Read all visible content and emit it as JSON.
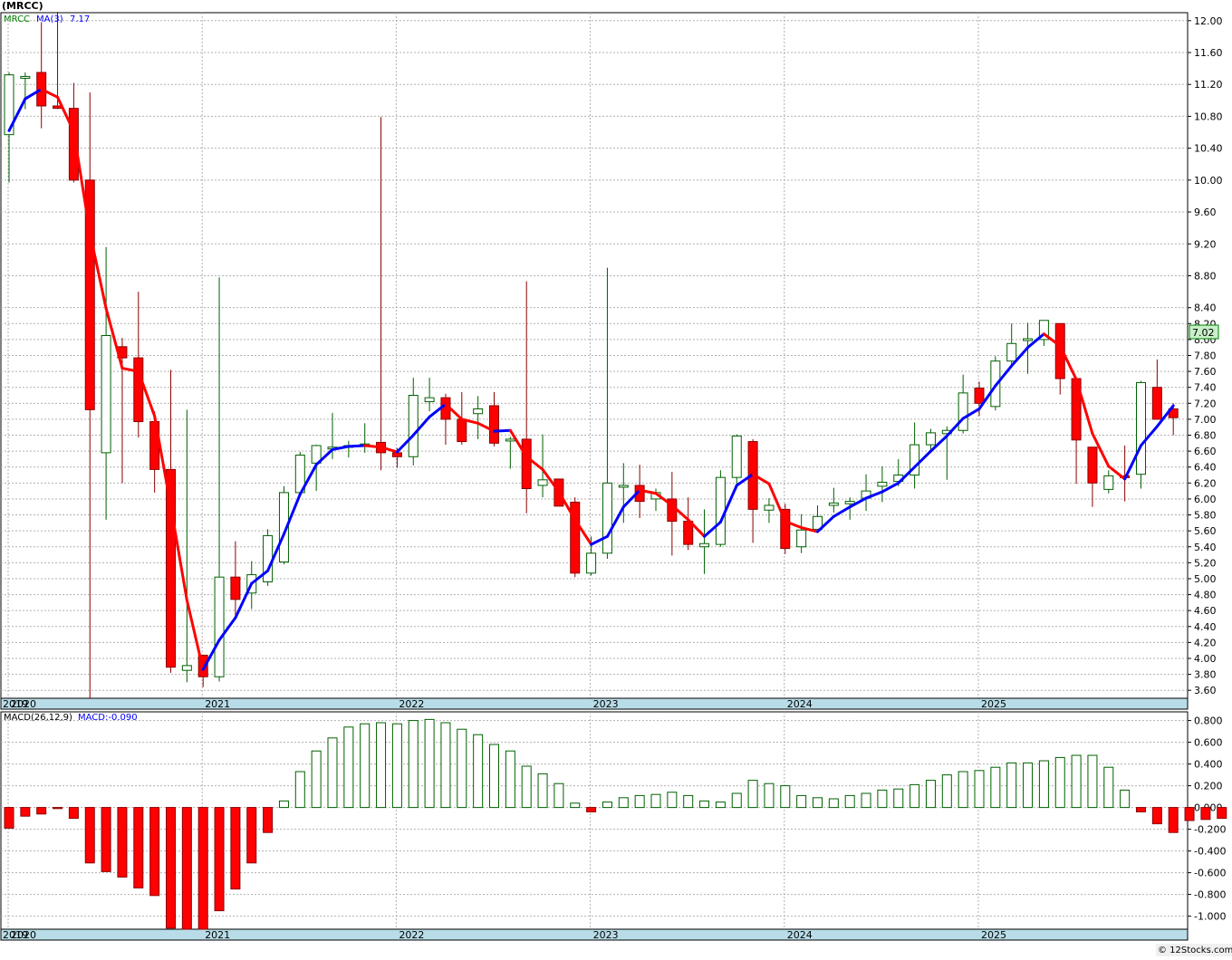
{
  "header": {
    "title": "(MRCC)"
  },
  "credit": "© 12Stocks.com",
  "colors": {
    "up": "#00a000",
    "down": "#ff0000",
    "ma_up": "#0000ff",
    "ma_down": "#ff0000",
    "grid": "#b0b0b0",
    "axis_band": "#b8dde8",
    "last_label_bg": "#c8f0c8"
  },
  "chart_data": [
    {
      "type": "candlestick",
      "title": "(MRCC)",
      "legend": {
        "symbol": "MRCC",
        "ma_label": "MA(3)",
        "ma_value": "7.17"
      },
      "last_price_label": "7.02",
      "ylim": [
        3.5,
        12.1
      ],
      "y_ticks": [
        "12.00",
        "11.60",
        "11.20",
        "10.80",
        "10.40",
        "10.00",
        "9.60",
        "9.20",
        "8.80",
        "8.40",
        "8.20",
        "8.00",
        "7.80",
        "7.60",
        "7.40",
        "7.20",
        "7.00",
        "6.80",
        "6.60",
        "6.40",
        "6.20",
        "6.00",
        "5.80",
        "5.60",
        "5.40",
        "5.20",
        "5.00",
        "4.80",
        "4.60",
        "4.40",
        "4.20",
        "4.00",
        "3.80",
        "3.60"
      ],
      "x_labels": [
        "2019",
        "2020",
        "2021",
        "2022",
        "2023",
        "2024",
        "2025"
      ],
      "x_label_index": [
        -4,
        0,
        12,
        24,
        36,
        48,
        60
      ],
      "candles": [
        {
          "o": 10.57,
          "h": 11.35,
          "l": 9.97,
          "c": 11.32
        },
        {
          "o": 11.3,
          "h": 11.35,
          "l": 10.89,
          "c": 11.3
        },
        {
          "o": 11.35,
          "h": 11.98,
          "l": 10.65,
          "c": 10.93
        },
        {
          "o": 10.93,
          "h": 12.11,
          "l": 10.89,
          "c": 10.9
        },
        {
          "o": 10.9,
          "h": 11.22,
          "l": 9.97,
          "c": 10.0
        },
        {
          "o": 10.0,
          "h": 11.1,
          "l": 3.5,
          "c": 7.12
        },
        {
          "o": 6.58,
          "h": 9.16,
          "l": 5.74,
          "c": 8.05
        },
        {
          "o": 7.91,
          "h": 8.02,
          "l": 6.2,
          "c": 7.77
        },
        {
          "o": 7.77,
          "h": 8.6,
          "l": 6.77,
          "c": 6.97
        },
        {
          "o": 6.97,
          "h": 7.1,
          "l": 6.08,
          "c": 6.37
        },
        {
          "o": 6.37,
          "h": 7.62,
          "l": 3.82,
          "c": 3.89
        },
        {
          "o": 3.85,
          "h": 7.12,
          "l": 3.7,
          "c": 3.91
        },
        {
          "o": 4.04,
          "h": 4.04,
          "l": 3.64,
          "c": 3.77
        },
        {
          "o": 3.77,
          "h": 8.78,
          "l": 3.71,
          "c": 5.02
        },
        {
          "o": 5.02,
          "h": 5.47,
          "l": 4.52,
          "c": 4.74
        },
        {
          "o": 4.82,
          "h": 5.22,
          "l": 4.62,
          "c": 5.05
        },
        {
          "o": 4.96,
          "h": 5.62,
          "l": 4.91,
          "c": 5.54
        },
        {
          "o": 5.21,
          "h": 6.16,
          "l": 5.18,
          "c": 6.08
        },
        {
          "o": 6.08,
          "h": 6.59,
          "l": 6.05,
          "c": 6.55
        },
        {
          "o": 6.45,
          "h": 6.68,
          "l": 6.1,
          "c": 6.67
        },
        {
          "o": 6.65,
          "h": 7.08,
          "l": 6.5,
          "c": 6.65
        },
        {
          "o": 6.67,
          "h": 6.73,
          "l": 6.52,
          "c": 6.67
        },
        {
          "o": 6.68,
          "h": 6.95,
          "l": 6.58,
          "c": 6.69
        },
        {
          "o": 6.71,
          "h": 10.79,
          "l": 6.36,
          "c": 6.58
        },
        {
          "o": 6.58,
          "h": 6.64,
          "l": 6.39,
          "c": 6.53
        },
        {
          "o": 6.53,
          "h": 7.52,
          "l": 6.42,
          "c": 7.3
        },
        {
          "o": 7.22,
          "h": 7.52,
          "l": 7.1,
          "c": 7.27
        },
        {
          "o": 7.27,
          "h": 7.32,
          "l": 6.68,
          "c": 7.0
        },
        {
          "o": 7.0,
          "h": 7.34,
          "l": 6.68,
          "c": 6.72
        },
        {
          "o": 7.07,
          "h": 7.29,
          "l": 6.75,
          "c": 7.13
        },
        {
          "o": 7.17,
          "h": 7.34,
          "l": 6.66,
          "c": 6.7
        },
        {
          "o": 6.73,
          "h": 6.78,
          "l": 6.38,
          "c": 6.75
        },
        {
          "o": 6.75,
          "h": 8.73,
          "l": 5.82,
          "c": 6.13
        },
        {
          "o": 6.17,
          "h": 6.81,
          "l": 6.02,
          "c": 6.24
        },
        {
          "o": 6.25,
          "h": 6.25,
          "l": 5.92,
          "c": 5.91
        },
        {
          "o": 5.96,
          "h": 6.02,
          "l": 5.02,
          "c": 5.07
        },
        {
          "o": 5.07,
          "h": 5.53,
          "l": 5.04,
          "c": 5.32
        },
        {
          "o": 5.32,
          "h": 8.9,
          "l": 5.25,
          "c": 6.2
        },
        {
          "o": 6.17,
          "h": 6.45,
          "l": 5.7,
          "c": 6.17
        },
        {
          "o": 6.17,
          "h": 6.43,
          "l": 5.76,
          "c": 5.97
        },
        {
          "o": 6.0,
          "h": 6.13,
          "l": 5.85,
          "c": 6.08
        },
        {
          "o": 6.0,
          "h": 6.34,
          "l": 5.29,
          "c": 5.72
        },
        {
          "o": 5.72,
          "h": 6.02,
          "l": 5.36,
          "c": 5.43
        },
        {
          "o": 5.4,
          "h": 5.87,
          "l": 5.06,
          "c": 5.44
        },
        {
          "o": 5.43,
          "h": 6.36,
          "l": 5.4,
          "c": 6.27
        },
        {
          "o": 6.27,
          "h": 6.81,
          "l": 6.13,
          "c": 6.79
        },
        {
          "o": 6.72,
          "h": 6.75,
          "l": 5.45,
          "c": 5.87
        },
        {
          "o": 5.86,
          "h": 6.01,
          "l": 5.7,
          "c": 5.92
        },
        {
          "o": 5.87,
          "h": 5.94,
          "l": 5.31,
          "c": 5.38
        },
        {
          "o": 5.4,
          "h": 5.81,
          "l": 5.32,
          "c": 5.61
        },
        {
          "o": 5.62,
          "h": 5.92,
          "l": 5.58,
          "c": 5.78
        },
        {
          "o": 5.92,
          "h": 6.14,
          "l": 5.83,
          "c": 5.95
        },
        {
          "o": 5.94,
          "h": 6.02,
          "l": 5.74,
          "c": 5.97
        },
        {
          "o": 6.01,
          "h": 6.31,
          "l": 5.85,
          "c": 6.1
        },
        {
          "o": 6.16,
          "h": 6.41,
          "l": 5.96,
          "c": 6.21
        },
        {
          "o": 6.22,
          "h": 6.5,
          "l": 6.16,
          "c": 6.3
        },
        {
          "o": 6.3,
          "h": 6.96,
          "l": 6.13,
          "c": 6.68
        },
        {
          "o": 6.68,
          "h": 6.88,
          "l": 6.59,
          "c": 6.83
        },
        {
          "o": 6.82,
          "h": 6.91,
          "l": 6.24,
          "c": 6.86
        },
        {
          "o": 6.86,
          "h": 7.56,
          "l": 6.82,
          "c": 7.33
        },
        {
          "o": 7.39,
          "h": 7.47,
          "l": 7.04,
          "c": 7.2
        },
        {
          "o": 7.16,
          "h": 7.79,
          "l": 7.11,
          "c": 7.73
        },
        {
          "o": 7.73,
          "h": 8.2,
          "l": 7.65,
          "c": 7.95
        },
        {
          "o": 7.99,
          "h": 8.21,
          "l": 7.57,
          "c": 8.01
        },
        {
          "o": 8.0,
          "h": 8.24,
          "l": 7.92,
          "c": 8.24
        },
        {
          "o": 8.2,
          "h": 8.2,
          "l": 7.31,
          "c": 7.51
        },
        {
          "o": 7.51,
          "h": 7.51,
          "l": 6.19,
          "c": 6.74
        },
        {
          "o": 6.65,
          "h": 6.65,
          "l": 5.9,
          "c": 6.2
        },
        {
          "o": 6.12,
          "h": 6.36,
          "l": 6.07,
          "c": 6.29
        },
        {
          "o": 6.29,
          "h": 6.67,
          "l": 5.97,
          "c": 6.27
        },
        {
          "o": 6.31,
          "h": 7.48,
          "l": 6.13,
          "c": 7.46
        },
        {
          "o": 7.4,
          "h": 7.75,
          "l": 7.0,
          "c": 7.0
        },
        {
          "o": 7.13,
          "h": 7.2,
          "l": 6.8,
          "c": 7.02
        }
      ],
      "ma": [
        10.62,
        11.02,
        11.14,
        11.04,
        10.61,
        9.34,
        8.39,
        7.64,
        7.6,
        7.04,
        5.91,
        4.73,
        3.86,
        4.23,
        4.51,
        4.94,
        5.1,
        5.56,
        6.06,
        6.43,
        6.62,
        6.66,
        6.67,
        6.65,
        6.59,
        6.8,
        7.03,
        7.19,
        7.0,
        6.95,
        6.85,
        6.86,
        6.53,
        6.37,
        6.09,
        5.74,
        5.43,
        5.53,
        5.9,
        6.11,
        6.07,
        5.92,
        5.74,
        5.53,
        5.71,
        6.17,
        6.31,
        6.19,
        5.72,
        5.64,
        5.59,
        5.78,
        5.9,
        6.01,
        6.09,
        6.2,
        6.4,
        6.6,
        6.79,
        7.01,
        7.13,
        7.42,
        7.67,
        7.9,
        8.07,
        7.92,
        7.5,
        6.82,
        6.41,
        6.25,
        6.67,
        6.91,
        7.17
      ]
    },
    {
      "type": "bar",
      "legend": {
        "name": "MACD(26,12,9)",
        "value_label": "MACD:-0.090"
      },
      "ylim": [
        -1.12,
        0.88
      ],
      "y_ticks": [
        "0.800",
        "0.600",
        "0.400",
        "0.200",
        "0.000",
        "-0.200",
        "-0.400",
        "-0.600",
        "-0.800",
        "-1.000"
      ],
      "x_labels": [
        "2019",
        "2020",
        "2021",
        "2022",
        "2023",
        "2024",
        "2025"
      ],
      "values": [
        -0.19,
        -0.08,
        -0.06,
        -0.01,
        -0.1,
        -0.51,
        -0.59,
        -0.64,
        -0.74,
        -0.81,
        -1.11,
        -1.12,
        -1.12,
        -0.95,
        -0.75,
        -0.51,
        -0.23,
        0.06,
        0.33,
        0.52,
        0.64,
        0.74,
        0.77,
        0.78,
        0.77,
        0.8,
        0.81,
        0.78,
        0.72,
        0.67,
        0.58,
        0.52,
        0.38,
        0.31,
        0.22,
        0.04,
        -0.04,
        0.05,
        0.09,
        0.11,
        0.12,
        0.14,
        0.11,
        0.06,
        0.05,
        0.13,
        0.25,
        0.22,
        0.2,
        0.11,
        0.09,
        0.08,
        0.11,
        0.13,
        0.16,
        0.17,
        0.21,
        0.25,
        0.3,
        0.33,
        0.34,
        0.37,
        0.41,
        0.41,
        0.43,
        0.46,
        0.48,
        0.48,
        0.37,
        0.16,
        -0.04,
        -0.15,
        -0.23,
        -0.12,
        -0.11,
        -0.1
      ]
    }
  ]
}
